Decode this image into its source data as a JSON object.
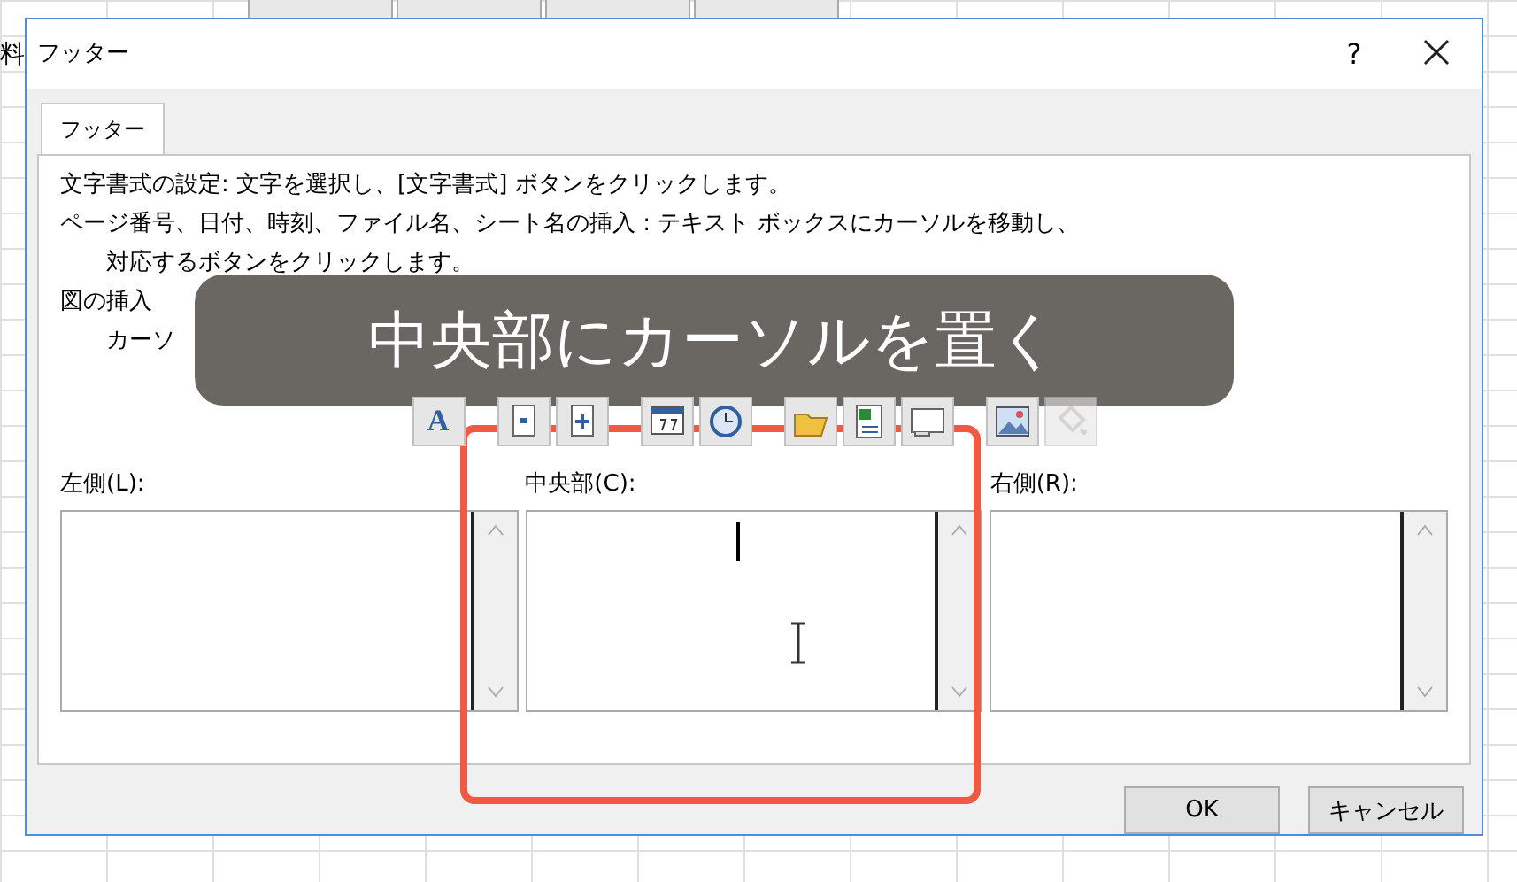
{
  "background": {
    "cell_text": "料"
  },
  "dialog": {
    "title": "フッター",
    "help": "?",
    "tabs": [
      {
        "label": "フッター",
        "selected": true
      }
    ],
    "instructions": [
      {
        "lines": [
          "文字書式の設定: 文字を選択し、[文字書式] ボタンをクリックします。"
        ]
      },
      {
        "lines": [
          "ページ番号、日付、時刻、ファイル名、シート名の挿入 : テキスト ボックスにカーソルを移動し、",
          "対応するボタンをクリックします。"
        ]
      },
      {
        "lines": [
          "図の挿入",
          "カーソ"
        ]
      }
    ],
    "toolbar": [
      [
        {
          "kind": "text-format",
          "disabled": false,
          "label": "A"
        }
      ],
      [
        {
          "kind": "page-number",
          "disabled": false
        },
        {
          "kind": "page-count",
          "disabled": false
        }
      ],
      [
        {
          "kind": "date",
          "disabled": false
        },
        {
          "kind": "time",
          "disabled": false
        }
      ],
      [
        {
          "kind": "file-path",
          "disabled": false
        },
        {
          "kind": "file-name",
          "disabled": false
        },
        {
          "kind": "sheet-name",
          "disabled": false
        }
      ],
      [
        {
          "kind": "picture",
          "disabled": false
        },
        {
          "kind": "format-picture",
          "disabled": true
        }
      ]
    ],
    "sections": [
      {
        "label": "左側(L):",
        "focused": false
      },
      {
        "label": "中央部(C):",
        "focused": true
      },
      {
        "label": "右側(R):",
        "focused": false
      }
    ],
    "buttons": [
      "OK",
      "キャンセル"
    ]
  },
  "caption": "中央部にカーソルを置く"
}
